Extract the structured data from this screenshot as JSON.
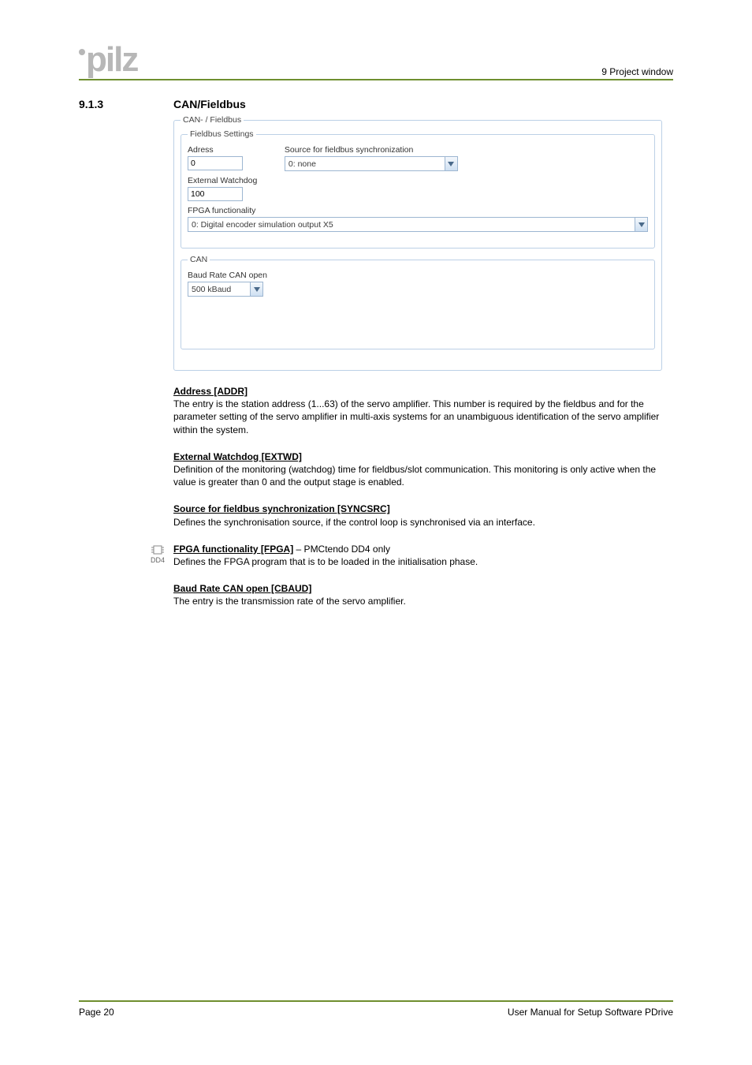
{
  "header": {
    "breadcrumb": "9  Project window"
  },
  "section": {
    "number": "9.1.3",
    "title": "CAN/Fieldbus"
  },
  "form": {
    "outer_legend": "CAN- / Fieldbus",
    "fieldbus": {
      "legend": "Fieldbus Settings",
      "address_label": "Adress",
      "address_value": "0",
      "syncsrc_label": "Source for fieldbus synchronization",
      "syncsrc_value": "0: none",
      "extwd_label": "External Watchdog",
      "extwd_value": "100",
      "fpga_label": "FPGA functionality",
      "fpga_value": "0: Digital encoder simulation output X5"
    },
    "can": {
      "legend": "CAN",
      "baud_label": "Baud Rate CAN open",
      "baud_value": "500 kBaud"
    }
  },
  "desc": {
    "addr_title": "Address [ADDR]",
    "addr_body": "The entry is the station address (1...63) of the servo amplifier. This number is required by the fieldbus  and for the parameter setting of the servo amplifier in multi-axis systems for an unambiguous identification of the servo amplifier within the system.",
    "extwd_title": "External Watchdog [EXTWD]",
    "extwd_body": "Definition of the monitoring (watchdog) time for fieldbus/slot communication. This monitoring is only active when the value is greater than 0 and the output stage is enabled.",
    "sync_title": "Source for fieldbus synchronization [SYNCSRC]",
    "sync_body": "Defines the synchronisation source, if the control loop is synchronised via an interface.",
    "fpga_title": "FPGA functionality [FPGA]",
    "fpga_suffix": " – PMCtendo DD4 only",
    "fpga_body": "Defines the FPGA program that is to be loaded in the initialisation phase.",
    "baud_title": "Baud Rate CAN open [CBAUD]",
    "baud_body": "The entry is the transmission rate of the servo amplifier."
  },
  "dd4_label": "DD4",
  "footer": {
    "left": "Page 20",
    "right": "User Manual for Setup Software PDrive"
  }
}
